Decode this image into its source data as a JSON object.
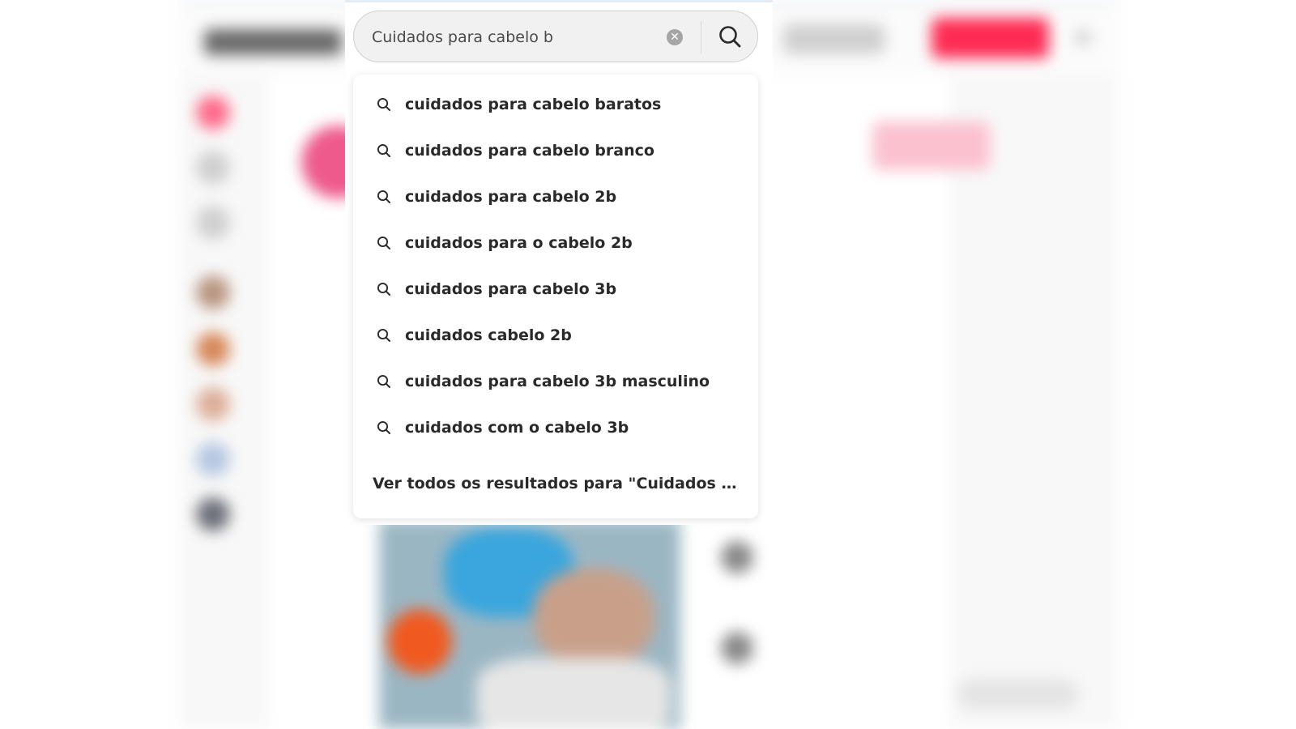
{
  "search": {
    "value": "Cuidados para cabelo b",
    "clear_icon": "close-circle-icon",
    "search_icon": "search-icon"
  },
  "suggestions": [
    {
      "label": "cuidados para cabelo baratos"
    },
    {
      "label": "cuidados para cabelo branco"
    },
    {
      "label": "cuidados para cabelo 2b"
    },
    {
      "label": "cuidados para o cabelo 2b"
    },
    {
      "label": "cuidados para cabelo 3b"
    },
    {
      "label": "cuidados cabelo 2b"
    },
    {
      "label": "cuidados para cabelo 3b masculino"
    },
    {
      "label": "cuidados com o cabelo 3b"
    }
  ],
  "view_all": "Ver todos os resultados para \"Cuidados pa...",
  "colors": {
    "accent": "#fe2c55",
    "text": "#2a2a2a"
  }
}
